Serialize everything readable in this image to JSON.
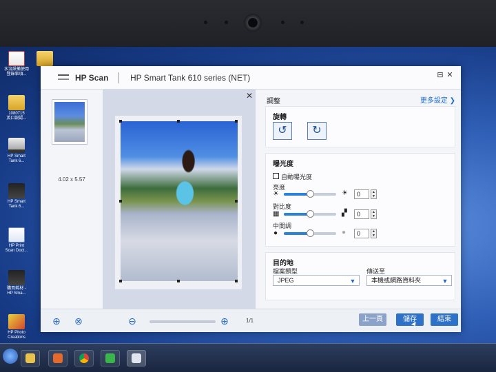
{
  "desktop": {
    "icons": [
      {
        "label": "水沒設備使用\n登錄事項...",
        "icon": "pdf-icon"
      },
      {
        "label": "",
        "icon": "folder-icon"
      },
      {
        "label": "1080715\n英口說認...",
        "icon": "folder-icon"
      },
      {
        "label": "HP Smart\nTank 6...",
        "icon": "scanner-icon"
      },
      {
        "label": "HP Smart\nTank 6...",
        "icon": "printer-icon"
      },
      {
        "label": "HP Print\nScan Doct...",
        "icon": "doc-icon"
      },
      {
        "label": "購買耗材 -\nHP Sma...",
        "icon": "printer-icon"
      },
      {
        "label": "HP Photo\nCreations",
        "icon": "photo-icon"
      }
    ]
  },
  "window": {
    "app_name": "HP Scan",
    "device_name": "HP Smart Tank 610 series (NET)",
    "controls": {
      "restore": "⊟",
      "close": "✕"
    }
  },
  "thumbnail": {
    "size_label": "4.02 x 5.57"
  },
  "preview": {
    "close": "✕"
  },
  "settings": {
    "title": "調整",
    "more_settings": "更多設定 ❯",
    "rotate": {
      "heading": "旋轉",
      "left_icon": "↺",
      "right_icon": "↻"
    },
    "exposure": {
      "heading": "曝光度",
      "auto_label": "自動曝光度",
      "auto_checked": false,
      "brightness": {
        "label": "亮度",
        "value": "0",
        "level": 0.5
      },
      "contrast": {
        "label": "對比度",
        "value": "0",
        "level": 0.5
      },
      "midtone": {
        "label": "中間調",
        "value": "0",
        "level": 0.5
      }
    },
    "destination": {
      "heading": "目的地",
      "file_type_label": "檔案類型",
      "file_type_value": "JPEG",
      "send_to_label": "傳送至",
      "send_to_value": "本機或網路資料夾"
    }
  },
  "bottom": {
    "page_count": "1/1",
    "prev_button": "上一頁",
    "save_button": "儲存",
    "end_button": "結束"
  }
}
